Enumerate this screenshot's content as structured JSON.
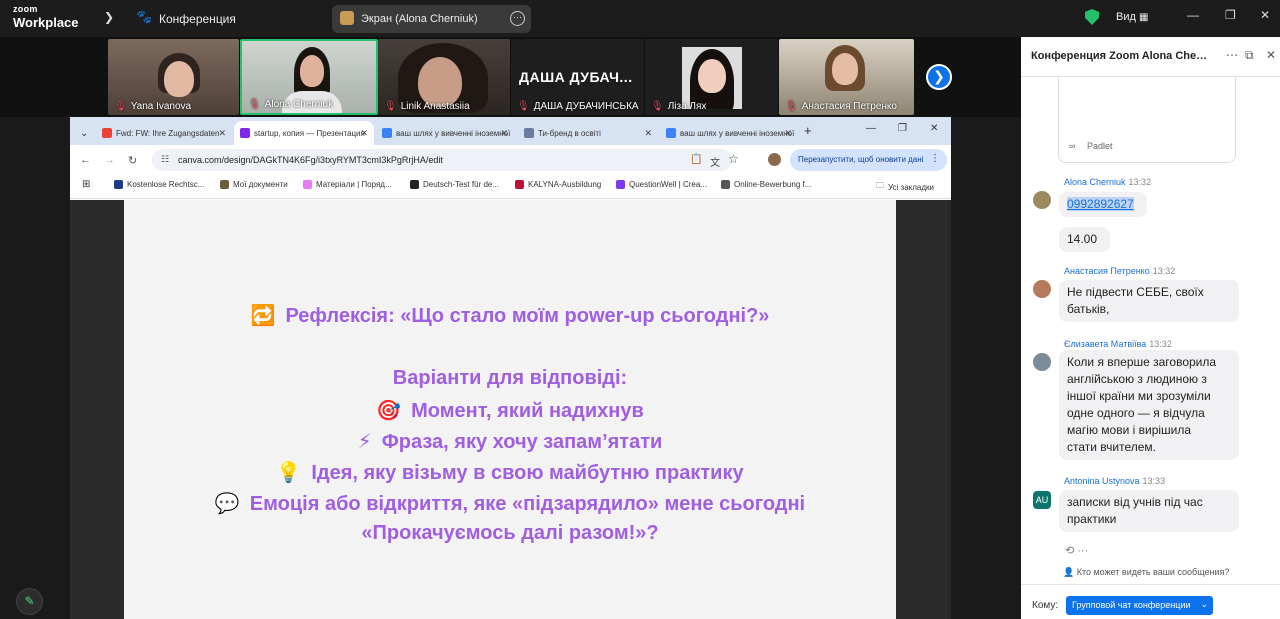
{
  "topbar": {
    "logo_line1": "zoom",
    "logo_line2": "Workplace",
    "chevron": "❯",
    "paw_icon": "🐾",
    "meeting_label": "Конференция",
    "share_title": "Экран (Alona Cherniuk)",
    "share_menu": "···",
    "view_label": "Вид",
    "view_icon": "▦",
    "minimize": "—",
    "restore": "❐",
    "close": "✕"
  },
  "participants": [
    {
      "name": "Yana Ivanova",
      "mic": "muted"
    },
    {
      "name": "Alona Cherniuk",
      "mic": "muted",
      "active": true
    },
    {
      "name": "Linik Anastasiia",
      "mic": "muted"
    },
    {
      "name": "ДАША ДУБАЧИНСЬКА",
      "mic": "muted",
      "display_text": "ДАША  ДУБАЧ..."
    },
    {
      "name": "Ліза Лях",
      "mic": "muted"
    },
    {
      "name": "Анастасия Петренко",
      "mic": "muted"
    }
  ],
  "participants_next": "❯",
  "mic_icon": "🎙",
  "browser": {
    "tabs": [
      {
        "label": "Fwd: FW: Ihre Zugangsdaten",
        "icon": "gmail-icon",
        "color": "#ea4335"
      },
      {
        "label": "startup, копия — Презентация",
        "icon": "canva-icon",
        "color": "#7d2ae8",
        "active": true
      },
      {
        "label": "ваш шлях у вивченні іноземної",
        "icon": "canva-icon",
        "color": "#3b82f6"
      },
      {
        "label": "Ти-бренд в освіті",
        "icon": "padlet-icon",
        "color": "#6b7aa1"
      },
      {
        "label": "ваш шлях у вивченні іноземної",
        "icon": "canva-icon",
        "color": "#3b82f6"
      }
    ],
    "tab_close": "✕",
    "new_tab": "+",
    "tab_menu": "⌄",
    "win_minimize": "—",
    "win_restore": "❐",
    "win_close": "✕",
    "nav_back": "←",
    "nav_forward": "→",
    "nav_reload": "↻",
    "site_icon": "☷",
    "url": "canva.com/design/DAGkTN4K6Fg/i3txyRYMT3cmI3kPgRrjHA/edit",
    "relaunch_label": "Перезапустити, щоб оновити дані",
    "menu_dots": "⋮",
    "bookmarks": [
      {
        "label": "Kostenlose Rechtsc...",
        "color": "#1e3a8a"
      },
      {
        "label": "Мої документи",
        "color": "#6b5e3a"
      },
      {
        "label": "Матеріали | Поряд...",
        "color": "#e879f9"
      },
      {
        "label": "Deutsch-Test für de...",
        "color": "#222222"
      },
      {
        "label": "KALYNA-Ausbildung",
        "color": "#be123c"
      },
      {
        "label": "QuestionWell | Crea...",
        "color": "#7c3aed"
      },
      {
        "label": "Online-Bewerbung f...",
        "color": "#555555"
      }
    ],
    "all_bookmarks": "Усі закладки",
    "apps_icon": "⊞",
    "folder_icon": "🗀"
  },
  "slide": {
    "title_emoji": "🔁",
    "title": "Рефлексія: «Що стало моїм power-up сьогодні?»",
    "subtitle": "Варіанти для відповіді:",
    "options": [
      {
        "emoji": "🎯",
        "text": "Момент, який надихнув"
      },
      {
        "emoji": "⚡",
        "text": "Фраза, яку хочу запам’ятати"
      },
      {
        "emoji": "💡",
        "text": "Ідея, яку візьму в свою майбутню практику"
      },
      {
        "emoji": "💬",
        "text": "Емоція або відкриття, яке «підзарядило» мене сьогодні"
      }
    ],
    "closing": "«Прокачуємось далі разом!»?"
  },
  "chat": {
    "title": "Конференция Zoom Alona Cherniuk",
    "more_icon": "⋯",
    "popout_icon": "⧉",
    "close_icon": "✕",
    "padlet_label": "Padlet",
    "padlet_icon": "∞",
    "messages": [
      {
        "sender": "Alona Cherniuk",
        "time": "13:32",
        "lines": [
          "0992892627"
        ],
        "is_link": true
      },
      {
        "sender": "",
        "time": "",
        "lines": [
          "14.00"
        ]
      },
      {
        "sender": "Анастасия Петренко",
        "time": "13:32",
        "lines": [
          "Не підвести СЕБЕ, своїх",
          "батьків,"
        ]
      },
      {
        "sender": "Єлизавета Матвіїва",
        "time": "13:32",
        "lines": [
          "Коли я вперше заговорила",
          "англійською з людиною з",
          "іншої країни ми зрозуміли",
          "одне одного — я відчула",
          "магію мови і вирішила",
          "стати вчителем."
        ]
      },
      {
        "sender": "Antonina Ustynova",
        "time": "13:33",
        "lines": [
          "записки від учнів під час",
          "практики"
        ],
        "avatar_initials": "AU"
      }
    ],
    "reaction_icons": "⟲  ···",
    "who_can_see": "Кто может видеть ваши сообщения?",
    "to_label": "Кому:",
    "to_value": "Групповой чат конференции",
    "to_chevron": "⌄"
  },
  "edit_icon": "✎",
  "colors": {
    "zoom_blue": "#0e72ed",
    "slide_text": "#a05ee0",
    "active_speaker": "#23c16b"
  }
}
